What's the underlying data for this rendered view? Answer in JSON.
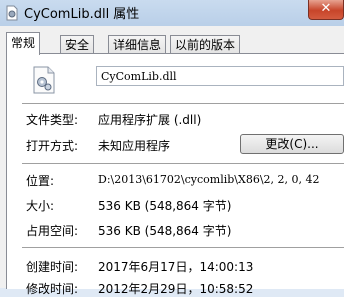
{
  "window": {
    "title": "CyComLib.dll 属性",
    "close_label": "✕"
  },
  "tabs": [
    {
      "label": "常规",
      "active": true
    },
    {
      "label": "安全"
    },
    {
      "label": "详细信息"
    },
    {
      "label": "以前的版本"
    }
  ],
  "general": {
    "file_name": "CyComLib.dll",
    "file_type_label": "文件类型:",
    "file_type_value": "应用程序扩展 (.dll)",
    "open_with_label": "打开方式:",
    "open_with_value": "未知应用程序",
    "change_button": "更改(C)...",
    "location_label": "位置:",
    "location_value": "D:\\2013\\61702\\cycomlib\\X86\\2, 2, 0, 42",
    "size_label": "大小:",
    "size_value": "536 KB (548,864 字节)",
    "size_on_disk_label": "占用空间:",
    "size_on_disk_value": "536 KB (548,864 字节)",
    "created_label": "创建时间:",
    "created_value": "2017年6月17日，14:00:13",
    "modified_label": "修改时间:",
    "modified_value": "2012年2月29日，10:58:52"
  }
}
